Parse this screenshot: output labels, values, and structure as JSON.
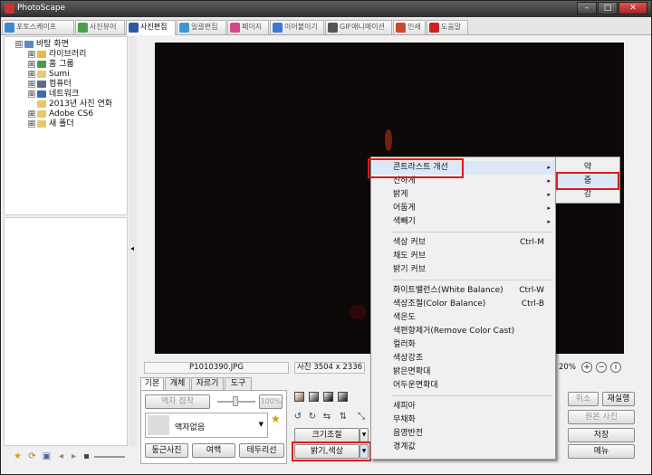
{
  "window": {
    "title": "PhotoScape",
    "min": "–",
    "max": "□",
    "close": "✕"
  },
  "tabs": [
    {
      "label": "포토스케이프",
      "color": "#3a8ad0"
    },
    {
      "label": "사진뷰어",
      "color": "#4aa04a"
    },
    {
      "label": "사진편집",
      "color": "#2a5aa0"
    },
    {
      "label": "일괄편집",
      "color": "#3a9ad0"
    },
    {
      "label": "페이지",
      "color": "#d04a8a"
    },
    {
      "label": "이어붙이기",
      "color": "#3a7ad0"
    },
    {
      "label": "GIF애니메이션",
      "color": "#555555"
    },
    {
      "label": "인쇄",
      "color": "#c84a2a"
    },
    {
      "label": "도움말",
      "color": "#d02020"
    }
  ],
  "tree": [
    {
      "label": "바탕 화면",
      "expander": "⊟",
      "color": "#5a8ac8"
    },
    {
      "label": "라이브러리",
      "expander": "⊞",
      "color": "#e8b840"
    },
    {
      "label": "홈 그룹",
      "expander": "⊞",
      "color": "#4a9a4a"
    },
    {
      "label": "Sumi",
      "expander": "⊞",
      "color": "#e8c870"
    },
    {
      "label": "컴퓨터",
      "expander": "⊞",
      "color": "#5a6a8a"
    },
    {
      "label": "네트워크",
      "expander": "⊞",
      "color": "#3a6ab0"
    },
    {
      "label": "2013년 사진 연화",
      "expander": "",
      "color": "#e8c860"
    },
    {
      "label": "Adobe CS6",
      "expander": "⊞",
      "color": "#e8c860"
    },
    {
      "label": "새 폴더",
      "expander": "⊞",
      "color": "#e8c860"
    }
  ],
  "status": {
    "filename": "P1010390.JPG",
    "dimensions": "사진 3504 x 2336",
    "zoom": "20%"
  },
  "subtabs": [
    "기본",
    "개체",
    "자르기",
    "도구"
  ],
  "basic": {
    "frame_btn": "액자 접착",
    "percent": "100%",
    "frame_select": "액자없음",
    "rounded": "둥근사진",
    "margin": "여백",
    "border": "테두리선"
  },
  "tools": {
    "resize": "크기조절",
    "brightness": "밝기,색상"
  },
  "right": {
    "cancel": "취소",
    "redo": "재실행",
    "original": "원본 사진",
    "save": "저장",
    "menu": "메뉴"
  },
  "menu": {
    "items": [
      {
        "label": "콘트라스트 개선",
        "arrow": "▸",
        "hl": true
      },
      {
        "label": "진하게",
        "arrow": "▸"
      },
      {
        "label": "밝게",
        "arrow": "▸"
      },
      {
        "label": "어둡게",
        "arrow": "▸"
      },
      {
        "label": "색빼기",
        "arrow": "▸"
      },
      {
        "label": "색상 커브",
        "shortcut": "Ctrl-M"
      },
      {
        "label": "채도 커브"
      },
      {
        "label": "밝기 커브"
      },
      {
        "label": "화이트밸런스(White Balance)",
        "shortcut": "Ctrl-W"
      },
      {
        "label": "색상조절(Color Balance)",
        "shortcut": "Ctrl-B"
      },
      {
        "label": "색온도"
      },
      {
        "label": "색편향제거(Remove Color Cast)"
      },
      {
        "label": "컬러화"
      },
      {
        "label": "색상강조"
      },
      {
        "label": "밝은면확대"
      },
      {
        "label": "어두운면확대"
      },
      {
        "label": "세피아"
      },
      {
        "label": "무채화"
      },
      {
        "label": "음영반전"
      },
      {
        "label": "경계값"
      }
    ]
  },
  "submenu": [
    "약",
    "중",
    "강"
  ],
  "colors": {
    "highlight_box": "#e01818",
    "canvas": "#0d0909"
  }
}
